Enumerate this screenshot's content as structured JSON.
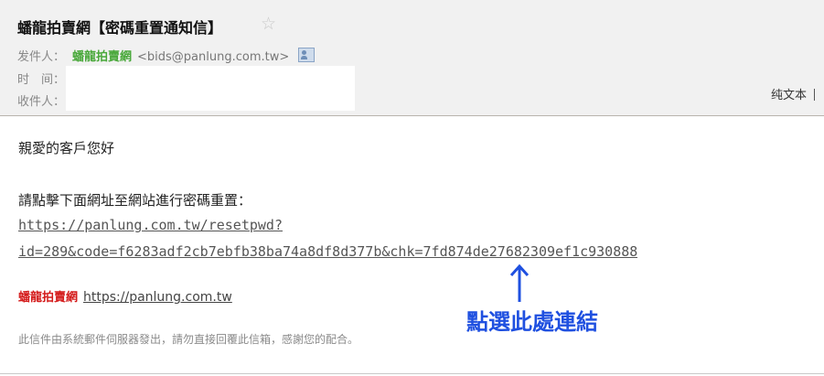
{
  "email": {
    "subject": "蟠龍拍賣網【密碼重置通知信】",
    "star_icon": "☆",
    "from_label": "发件人：",
    "sender_name": "蟠龍拍賣網",
    "sender_email": "<bids@panlung.com.tw>",
    "time_label": "时　间：",
    "to_label": "收件人：",
    "plain_text_toggle": "纯文本"
  },
  "body": {
    "greeting": "親愛的客戶您好",
    "instruction": "請點擊下面網址至網站進行密碼重置：",
    "reset_link_line1": "https://panlung.com.tw/resetpwd?",
    "reset_link_line2": "id=289&code=f6283adf2cb7ebfb38ba74a8df8d377b&chk=7fd874de27682309ef1c930888",
    "signature_brand": "蟠龍拍賣網",
    "signature_url": "https://panlung.com.tw",
    "footer_note": "此信件由系統郵件伺服器發出，請勿直接回覆此信箱，感謝您的配合。"
  },
  "annotation": {
    "callout_text": "點選此處連結",
    "color": "#1f50e0"
  }
}
